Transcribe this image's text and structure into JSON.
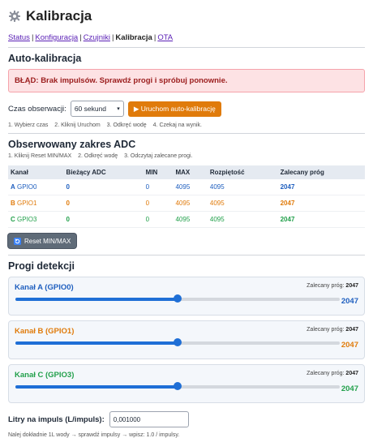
{
  "header": {
    "title": "Kalibracja",
    "icon": "gear-icon"
  },
  "nav": {
    "items": [
      {
        "label": "Status",
        "active": false
      },
      {
        "label": "Konfiguracja",
        "active": false
      },
      {
        "label": "Czujniki",
        "active": false
      },
      {
        "label": "Kalibracja",
        "active": true
      },
      {
        "label": "OTA",
        "active": false
      }
    ]
  },
  "auto": {
    "heading": "Auto-kalibracja",
    "error": "BŁĄD: Brak impulsów. Sprawdź progi i spróbuj ponownie.",
    "time_label": "Czas obserwacji:",
    "time_value": "60 sekund",
    "start_button": "▶ Uruchom auto-kalibrację",
    "steps": [
      "1. Wybierz czas",
      "2. Kliknij Uruchom",
      "3. Odkręć wodę",
      "4. Czekaj na wynik."
    ]
  },
  "adc": {
    "heading": "Obserwowany zakres ADC",
    "steps": [
      "1. Kliknij Reset MIN/MAX",
      "2. Odkręć wodę",
      "3. Odczytaj zalecane progi."
    ],
    "columns": [
      "Kanał",
      "Bieżący ADC",
      "MIN",
      "MAX",
      "Rozpiętość",
      "Zalecany próg"
    ],
    "rows": [
      {
        "letter": "A",
        "gpio": "GPIO0",
        "current": "0",
        "min": "0",
        "max": "4095",
        "range": "4095",
        "rec": "2047",
        "color": "blue"
      },
      {
        "letter": "B",
        "gpio": "GPIO1",
        "current": "0",
        "min": "0",
        "max": "4095",
        "range": "4095",
        "rec": "2047",
        "color": "orange"
      },
      {
        "letter": "C",
        "gpio": "GPIO3",
        "current": "0",
        "min": "0",
        "max": "4095",
        "range": "4095",
        "rec": "2047",
        "color": "green"
      }
    ],
    "reset_button": "Reset MIN/MAX"
  },
  "thresholds": {
    "heading": "Progi detekcji",
    "rec_label": "Zalecany próg:",
    "channels": [
      {
        "name": "Kanał A (GPIO0)",
        "rec": "2047",
        "value": "2047",
        "fraction": 0.5,
        "color": "#1f5fbf"
      },
      {
        "name": "Kanał B (GPIO1)",
        "rec": "2047",
        "value": "2047",
        "fraction": 0.5,
        "color": "#e07b0b"
      },
      {
        "name": "Kanał C (GPIO3)",
        "rec": "2047",
        "value": "2047",
        "fraction": 0.5,
        "color": "#22a04b"
      }
    ]
  },
  "liters": {
    "label": "Litry na impuls (L/impuls):",
    "value": "0,001000",
    "note": "Nalej dokładnie 1L wody → sprawdź impulsy → wpisz: 1.0 / impulsy."
  }
}
